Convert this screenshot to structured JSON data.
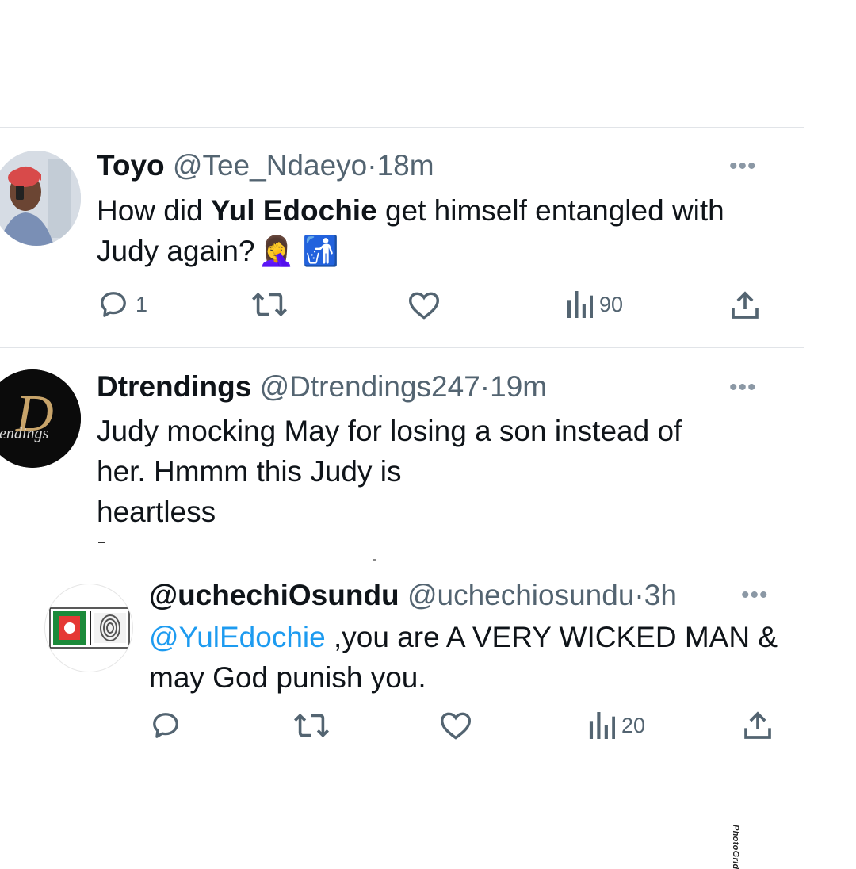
{
  "tweets": [
    {
      "name": "Toyo",
      "handle": "@Tee_Ndaeyo",
      "dot": "·",
      "time": "18m",
      "text_part1": "How did ",
      "text_bold": "Yul Edochie",
      "text_part2": " get himself entangled with Judy again?",
      "emoji1": "🤦‍♀️",
      "emoji2": "🚮",
      "replies": "1",
      "retweets": "",
      "likes": "",
      "views": "90"
    },
    {
      "name": "Dtrendings",
      "handle": "@Dtrendings247",
      "dot": "·",
      "time": "19m",
      "text_line1": "Judy mocking May for losing a son instead of",
      "text_line2": "her. Hmmm this Judy is",
      "text_line3": "heartless",
      "avatar_text_big": "D",
      "avatar_text_small": "rendings"
    },
    {
      "name": "@uchechiOsundu",
      "handle": "@uchechiosundu",
      "dot": "·",
      "time": "3h",
      "mention": "@YulEdochie",
      "text_rest": " ,you are A VERY WICKED MAN &",
      "text_line2": "may God punish you.",
      "replies": "",
      "retweets": "",
      "likes": "",
      "views": "20"
    }
  ],
  "more_label": "•••",
  "watermark": "PhotoGrid",
  "colors": {
    "text": "#0f1419",
    "secondary": "#536471",
    "link": "#1d9bf0",
    "divider": "#e1e4e8"
  }
}
